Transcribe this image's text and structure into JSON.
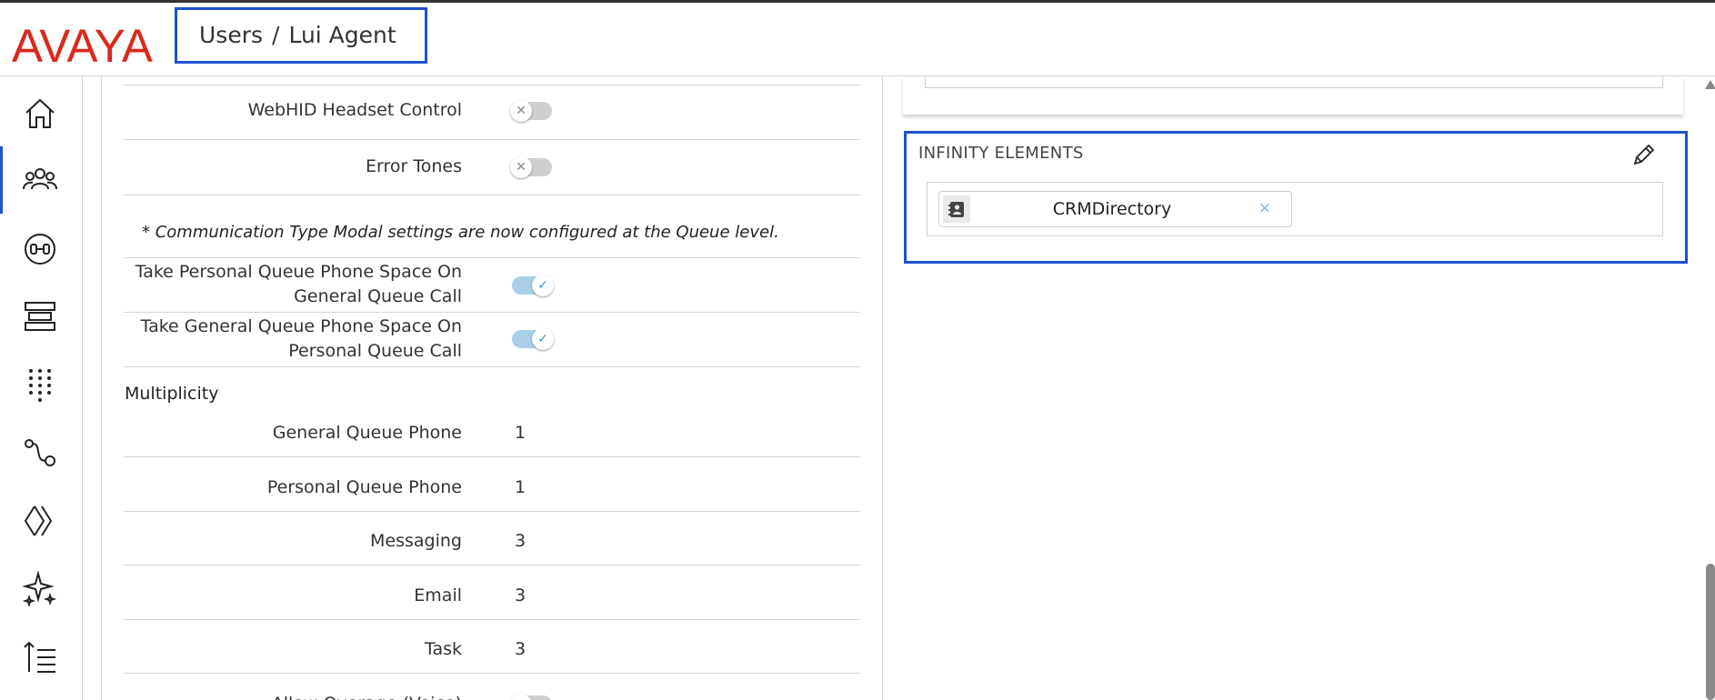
{
  "header": {
    "logo_text": "AVAYA",
    "breadcrumb": {
      "section": "Users",
      "separator": "/",
      "current": "Lui Agent"
    }
  },
  "sidebar": {
    "items": [
      {
        "icon": "home-icon"
      },
      {
        "icon": "users-icon",
        "active": true
      },
      {
        "icon": "headset-icon"
      },
      {
        "icon": "queue-stack-icon"
      },
      {
        "icon": "dialpad-icon"
      },
      {
        "icon": "route-icon"
      },
      {
        "icon": "integrations-icon"
      },
      {
        "icon": "sparkles-icon"
      },
      {
        "icon": "sort-list-icon"
      }
    ]
  },
  "settings": {
    "webhid": {
      "label": "WebHID Headset Control",
      "on": false
    },
    "error_tones": {
      "label": "Error Tones",
      "on": false
    },
    "note": "* Communication Type Modal settings are now configured at the Queue level.",
    "take_personal": {
      "label_line1": "Take Personal Queue Phone Space On",
      "label_line2": "General Queue Call",
      "on": true
    },
    "take_general": {
      "label_line1": "Take General Queue Phone Space On",
      "label_line2": "Personal Queue Call",
      "on": true
    },
    "multiplicity_title": "Multiplicity",
    "multiplicity": [
      {
        "label": "General Queue Phone",
        "value": "1"
      },
      {
        "label": "Personal Queue Phone",
        "value": "1"
      },
      {
        "label": "Messaging",
        "value": "3"
      },
      {
        "label": "Email",
        "value": "3"
      },
      {
        "label": "Task",
        "value": "3"
      }
    ],
    "allow_overage": {
      "label": "Allow Overage (Voice)",
      "on": false
    }
  },
  "infinity_elements": {
    "title": "INFINITY ELEMENTS",
    "edit_icon": "pencil-icon",
    "chips": [
      {
        "label": "CRMDirectory",
        "icon": "contact-book-icon",
        "remove": "×"
      }
    ]
  },
  "colors": {
    "brand_red": "#da291c",
    "highlight_blue": "#1f4fd1",
    "toggle_on": "#a9cfe8",
    "toggle_off": "#cfcfcf"
  }
}
